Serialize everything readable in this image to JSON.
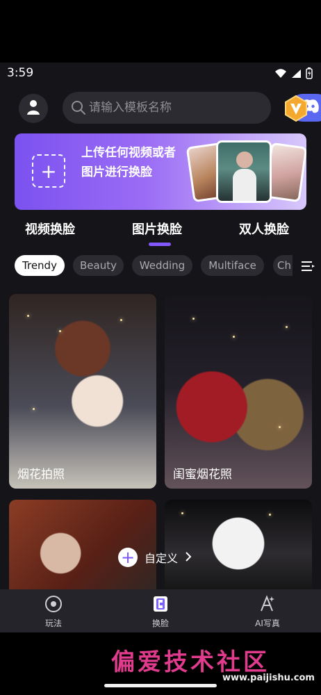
{
  "status_bar": {
    "time": "3:59",
    "icons": [
      "wifi-icon",
      "signal-icon",
      "battery-icon"
    ]
  },
  "header": {
    "search_placeholder": "请输入模板名称",
    "icons": [
      "user-icon",
      "search-icon",
      "discord-icon",
      "vip-v-icon"
    ]
  },
  "banner": {
    "text": "上传任何视频或者图片进行换脸",
    "plus": "+"
  },
  "category_tabs": [
    "视频换脸",
    "图片换脸",
    "双人换脸"
  ],
  "selected_tab": "图片换脸",
  "filters": {
    "active": "Trendy",
    "items": [
      "Trendy",
      "Beauty",
      "Wedding",
      "Multiface",
      "Ch"
    ]
  },
  "grid": {
    "cards": [
      {
        "title": "烟花拍照"
      },
      {
        "title": "闺蜜烟花照"
      },
      {
        "title": ""
      },
      {
        "title": ""
      }
    ]
  },
  "custom": {
    "label": "自定义",
    "plus": "+"
  },
  "bottom_nav": {
    "items": [
      {
        "label": "玩法",
        "icon": "target-icon"
      },
      {
        "label": "换脸",
        "icon": "face-swap-icon"
      },
      {
        "label": "AI写真",
        "icon": "ai-portrait-icon"
      }
    ]
  },
  "watermark": {
    "title": "偏爱技术社区",
    "url": "www.paijishu.com"
  },
  "colors": {
    "background": "#151519",
    "accent": "#8458ff",
    "discord": "#5a67f0",
    "active_chip": "#ffffff"
  }
}
